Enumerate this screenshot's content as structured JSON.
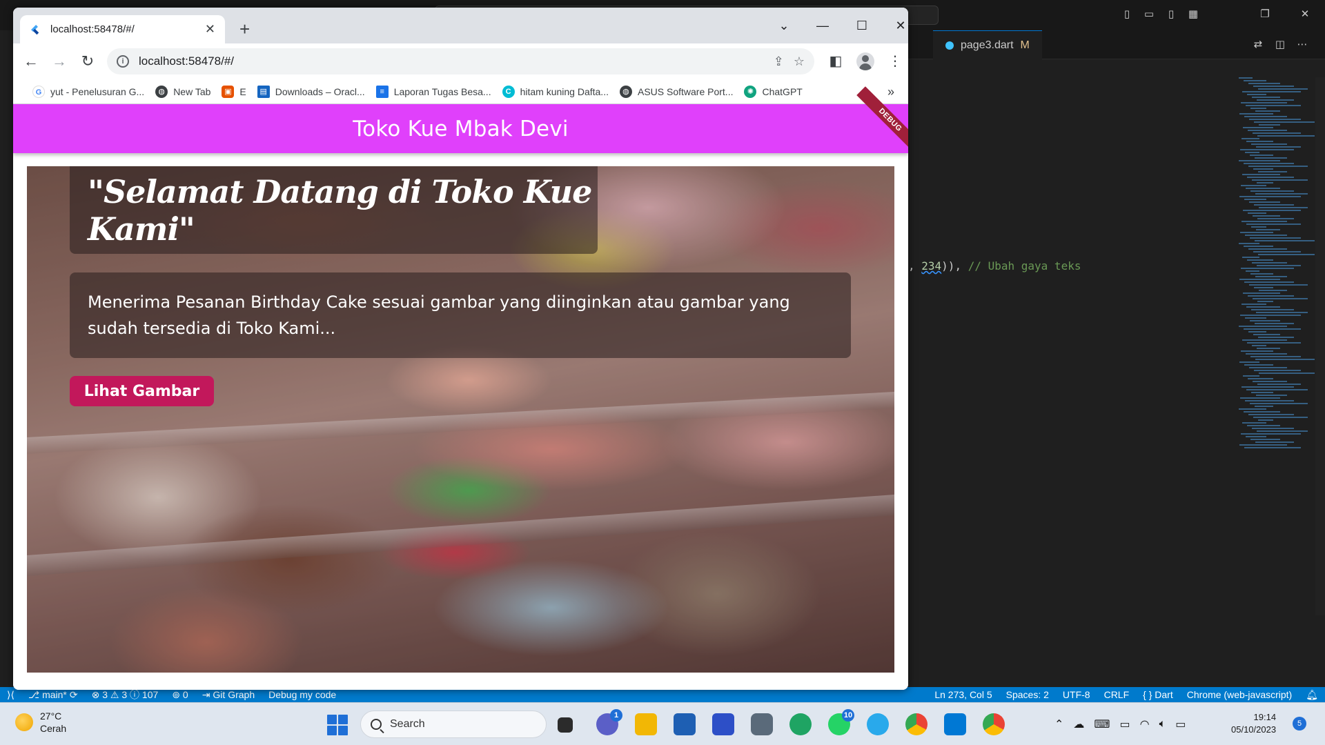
{
  "vscode": {
    "tab_file": "page3.dart",
    "tab_status": "M",
    "code_number": "234",
    "code_comment": "// Ubah gaya teks",
    "statusbar": {
      "branch": "main*",
      "problems": "⊗ 3 ⚠ 3 ⓘ 107",
      "ports": "⊚ 0",
      "git_graph": "Git Graph",
      "debug": "Debug my code",
      "position": "Ln 273, Col 5",
      "spaces": "Spaces: 2",
      "encoding": "UTF-8",
      "eol": "CRLF",
      "language": "{ } Dart",
      "device": "Chrome (web-javascript)"
    }
  },
  "browser": {
    "tab_title": "localhost:58478/#/",
    "url": "localhost:58478/#/",
    "bookmarks": [
      {
        "label": "yut - Penelusuran G...",
        "icon": "google-icon",
        "color": "#4285f4"
      },
      {
        "label": "New Tab",
        "icon": "globe-icon",
        "color": "#3c4043"
      },
      {
        "label": "E",
        "icon": "bot-icon",
        "color": "#e65100"
      },
      {
        "label": "Downloads – Oracl...",
        "icon": "oracle-icon",
        "color": "#1565c0"
      },
      {
        "label": "Laporan Tugas Besa...",
        "icon": "docs-icon",
        "color": "#1a73e8"
      },
      {
        "label": "hitam kuning Dafta...",
        "icon": "canva-icon",
        "color": "#00bcd4"
      },
      {
        "label": "ASUS Software Port...",
        "icon": "globe-icon",
        "color": "#3c4043"
      },
      {
        "label": "ChatGPT",
        "icon": "chatgpt-icon",
        "color": "#10a37f"
      }
    ]
  },
  "app": {
    "title": "Toko Kue Mbak Devi",
    "debug_banner": "DEBUG",
    "welcome": "\"Selamat Datang di Toko Kue Kami\"",
    "description": "Menerima Pesanan Birthday Cake sesuai gambar yang diinginkan atau gambar yang sudah tersedia di Toko Kami...",
    "button_label": "Lihat Gambar",
    "accent": "#e040fb",
    "button_color": "#c2185b"
  },
  "taskbar": {
    "temperature": "27°C",
    "weather": "Cerah",
    "search_placeholder": "Search",
    "teams_badge": "1",
    "whatsapp_badge": "10",
    "time": "19:14",
    "date": "05/10/2023",
    "notifications": "5"
  }
}
